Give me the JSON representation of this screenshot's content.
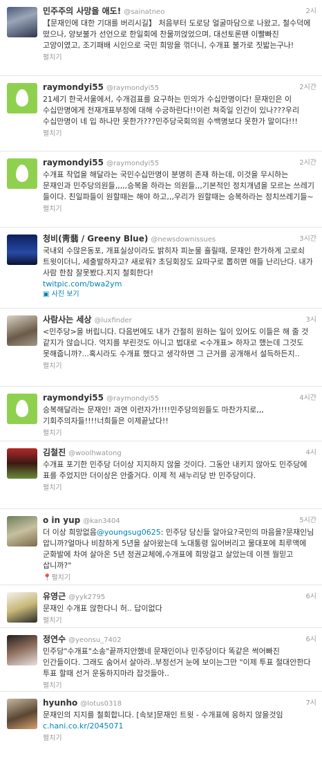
{
  "colors": {
    "accent": "#0084b4",
    "muted": "#999999",
    "egg": "#8fd14f"
  },
  "tweets": [
    {
      "name": "민주주의 사망을 애도!",
      "handle": "@sainatneo",
      "time": "2시",
      "text": "【문재인에 대한 기대를 버리시길】 처음부터 도로당 얼굴마담으로 나왔고, 철수덕에 떴으나, 양보불가 선언으로 한일회에 찬물끼얹었으며, 대선토론땐 이빨빠진 고양이였고, 조기패배 시인으로 국민 희망을 꺾더니, 수개표 불가로 짓밟는구나!",
      "footer": "펼치기"
    },
    {
      "name": "raymondyi55",
      "handle": "@raymondyi55",
      "time": "2시간",
      "text": "21세기 한국서울에서, 수개검표를 요구하는 민의가 수십만명이다! 문재인은 이 수십만명에게 전재개표부정에 대해 수긍하란다!!이런 쳐죽일 인간이 있나???우리 수십만명이 네 입 하나만 못한가???민주당국회의원 수백명보다 못한가 말이다!!!",
      "footer": "펼치기"
    },
    {
      "name": "raymondyi55",
      "handle": "@raymondyi55",
      "time": "2시간",
      "text": "수개표 작업을 해달라는 국민수십만명이 분명히 존재 하는데, 이것을 무시하는 문재인과 민주당의원들,,,,,승복을 하라는 의원들,,,기본적인 정치개념을 모르는 쓰레기 들이다. 친일파들이 원할때는 해야 하고,,,우리가 원할때는 승복하라는 정치쓰레기들~",
      "footer": "펼치기"
    },
    {
      "name": "청비(靑翡 / Greeny Blue)",
      "handle": "@newsdownissues",
      "time": "3시간",
      "text": "국내외 수많은동포, 개표실상이라도 밝히자 피눈물 흘릴때, 문재인 한가하게 고로쇠 트윗이더니, 세출발하자고? 새로워? 초딩회장도 요따구로 뽑히면 애들 난리난다. 내가 사람 한참 잘못봤다.지지 철회한다!",
      "link": "twitpic.com/bwa2ym",
      "media": "사진 보기"
    },
    {
      "name": "사람사는 세상",
      "handle": "@luxfinder",
      "time": "3시",
      "text": "<민주당>을 버립니다. 다음번에도 내가 간절히 원하는 일이 있어도 이들은 해 줄 것 같지가 않습니다. 억지를 부린것도 아니고 법대로 <수개표> 하자고 했는데 그것도 못해줍니까?...혹시라도 수개표 했다고 생각하면 그 근거를 공개해서 설득하든지..",
      "footer": "펼치기"
    },
    {
      "name": "raymondyi55",
      "handle": "@raymondyi55",
      "time": "4시간",
      "text": "승복해달라는 문재인! 과연 이런자가!!!!민주당의원들도 마찬가지로,,,기회주의자들!!!!너희들은 이제끝났다!!",
      "footer": "펼치기"
    },
    {
      "name": "김철진",
      "handle": "@woolhwatong",
      "time": "4시",
      "text": "수개표 포기한 민주당 더이상 지지하지 않을 것이다. 그동안 내키지 않아도 민주당에 표를 주었지만 더이상은 안줄거다. 이제 적 새누리당 반 민주당이다.",
      "footer": "펼치기"
    },
    {
      "name": "o in yup",
      "handle": "@kan3404",
      "time": "5시간",
      "text_pre": "더 이상 희망없음",
      "mention": "@youngsug0625",
      "text_post": ": 민주당 당신들 알아요?국민의 마음을?문재인님 압니까?얼마나 비참하게 5년을 살아왔는데 노대통령 잃어버리고 물대포에 최루액에 군화발에 차여 살아온 5년 정권교체에,수개표에 희망걸고 살았는데 이젠 뭘믿고 삽니까?\"",
      "location": "펼치기"
    },
    {
      "name": "유영근",
      "handle": "@yyk2795",
      "time": "6시",
      "text": "문재인 수개표 않한다니 허.. 답이없다",
      "footer": "펼치기"
    },
    {
      "name": "정연수",
      "handle": "@yeonsu_7402",
      "time": "6시",
      "text": "민주당\"수개표\"소송\"끝까지안했네 문재인이나 민주당이다 똑같은 썩어빠진 인간들이다. 그래도 숨어서 살아라..부정선거 눈에 보이는그만 \"이제 투표 절대안한다 투표 할때 선거 운동하지마라 잡것들아..",
      "footer": "펼치기"
    },
    {
      "name": "hyunho",
      "handle": "@lotus0318",
      "time": "7시",
      "text": "문재인의 지지를 철회합니다. [속보]문재인 트윗 - 수개표에 응하지 않을것임",
      "link": "c.hani.co.kr/2045071",
      "footer": "펼치기"
    }
  ]
}
